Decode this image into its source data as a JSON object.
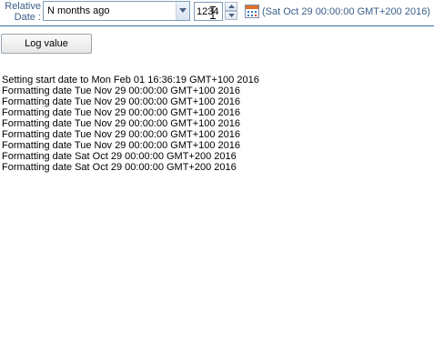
{
  "form": {
    "label_line1": "Relative",
    "label_line2": "Date :",
    "select_value": "N months ago",
    "number_value": "1234",
    "date_preview": "(Sat Oct 29 00:00:00 GMT+200 2016)"
  },
  "actions": {
    "log_button_label": "Log value"
  },
  "log": [
    "Setting start date to Mon Feb 01 16:36:19 GMT+100 2016",
    "Formatting date Tue Nov 29 00:00:00 GMT+100 2016",
    "Formatting date Tue Nov 29 00:00:00 GMT+100 2016",
    "Formatting date Tue Nov 29 00:00:00 GMT+100 2016",
    "Formatting date Tue Nov 29 00:00:00 GMT+100 2016",
    "Formatting date Tue Nov 29 00:00:00 GMT+100 2016",
    "Formatting date Tue Nov 29 00:00:00 GMT+100 2016",
    "Formatting date Sat Oct 29 00:00:00 GMT+200 2016",
    "Formatting date Sat Oct 29 00:00:00 GMT+200 2016"
  ],
  "icons": {
    "select_arrow": "chevron-down-icon",
    "spin_up": "spin-up-icon",
    "spin_down": "spin-down-icon",
    "calendar": "calendar-icon",
    "cursor": "text-cursor-icon"
  },
  "colors": {
    "label": "#3a5f8a",
    "border": "#7f9db9",
    "panel_rule": "#3a6ea5"
  }
}
